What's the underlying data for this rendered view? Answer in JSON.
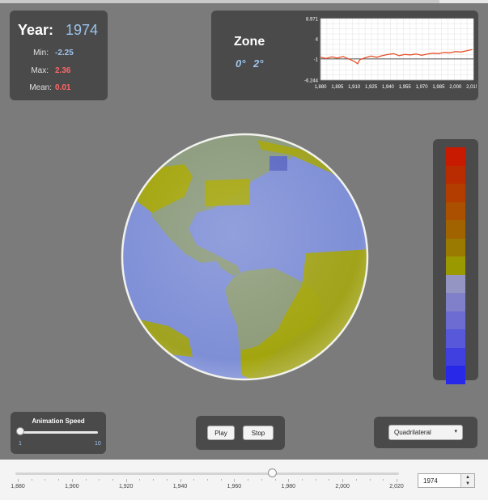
{
  "stats": {
    "year_label": "Year:",
    "year_value": "1974",
    "min_label": "Min:",
    "min_value": "-2.25",
    "max_label": "Max:",
    "max_value": "2.36",
    "mean_label": "Mean:",
    "mean_value": "0.01"
  },
  "zone": {
    "title": "Zone",
    "lat": "0°",
    "lon": "2°"
  },
  "chart_data": {
    "type": "line",
    "title": "",
    "xlabel": "",
    "ylabel": "",
    "xlim": [
      1880,
      2016
    ],
    "ylim": [
      -6.244,
      8.971
    ],
    "y_ticks": [
      "8.971",
      "4",
      "-1",
      "-6.244"
    ],
    "x_ticks": [
      "1,880",
      "1,895",
      "1,910",
      "1,925",
      "1,940",
      "1,955",
      "1,970",
      "1,985",
      "2,000",
      "2,015"
    ],
    "x_tick_values": [
      1880,
      1895,
      1910,
      1925,
      1940,
      1955,
      1970,
      1985,
      2000,
      2015
    ],
    "y_tick_values": [
      8.971,
      4,
      -1,
      -6.244
    ],
    "reference_line": -1,
    "grid": true,
    "legend": "none",
    "series": [
      {
        "color": "#e8522a",
        "x": [
          1880,
          1885,
          1890,
          1895,
          1900,
          1905,
          1910,
          1913,
          1915,
          1920,
          1925,
          1930,
          1935,
          1940,
          1945,
          1950,
          1955,
          1960,
          1965,
          1970,
          1975,
          1980,
          1985,
          1990,
          1995,
          2000,
          2005,
          2010,
          2015
        ],
        "y": [
          -0.6,
          -0.9,
          -0.5,
          -0.8,
          -0.4,
          -1.0,
          -1.6,
          -2.2,
          -1.2,
          -0.7,
          -0.3,
          -0.6,
          -0.2,
          0.1,
          0.3,
          -0.2,
          0.1,
          0.0,
          0.2,
          -0.1,
          0.2,
          0.4,
          0.3,
          0.6,
          0.5,
          0.8,
          0.7,
          1.0,
          1.3
        ]
      }
    ]
  },
  "legend_colors": [
    "#c81a00",
    "#b92b00",
    "#b33d00",
    "#ab5000",
    "#a16200",
    "#9a7a00",
    "#9a9a00",
    "#9595c3",
    "#7f7fca",
    "#6c6cd2",
    "#5858da",
    "#4040e0",
    "#2828e8"
  ],
  "speed": {
    "title": "Animation Speed",
    "min": "1",
    "max": "10"
  },
  "controls": {
    "play": "Play",
    "stop": "Stop",
    "shape": "Quadrilateral",
    "shape_arrow": "▾"
  },
  "timeline": {
    "min_year": 1880,
    "max_year": 2020,
    "current_year": 1974,
    "labels": [
      "1,880",
      "1,900",
      "1,920",
      "1,940",
      "1,960",
      "1,980",
      "2,000",
      "2,020"
    ],
    "spinner_value": "1974",
    "spinner_up": "▲",
    "spinner_down": "▼"
  },
  "colors": {
    "panel": "#4a4a4a",
    "background": "#7b7b7b",
    "accent_blue": "#9cc3ec",
    "accent_red": "#ff6666",
    "ocean": "#7f8fd6",
    "land": "#8b9a7c",
    "anomaly_yellow": "#a6a600"
  }
}
